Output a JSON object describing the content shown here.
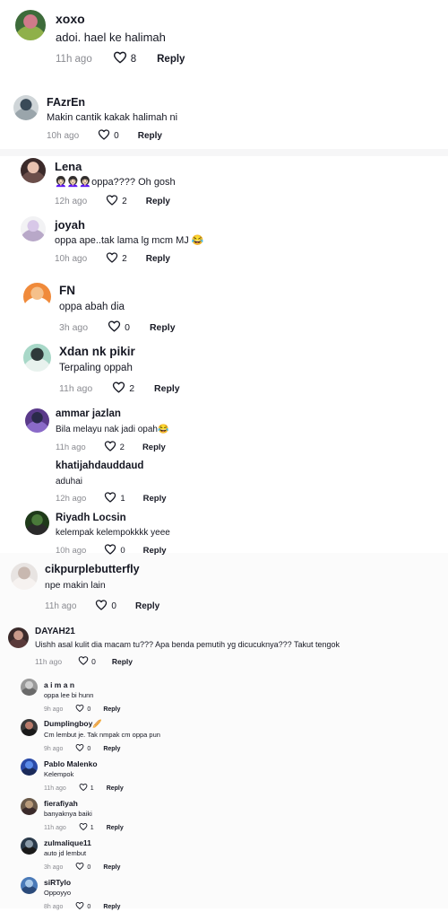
{
  "comments": [
    {
      "name": "xoxo",
      "text": "adoi. hael ke halimah",
      "time": "11h ago",
      "likes": "8",
      "reply": "Reply",
      "avatar": [
        "#3d6b3a",
        "#d07a8a",
        "#8fb04a"
      ]
    },
    {
      "name": "FAzrEn",
      "text": "Makin cantik kakak halimah ni",
      "time": "10h ago",
      "likes": "0",
      "reply": "Reply",
      "avatar": [
        "#cfd5d8",
        "#3a4a58",
        "#9aa5ab"
      ]
    },
    {
      "name": "Lena",
      "text": "👩🏻‍🦱👩🏻‍🦱👩🏻‍🦱oppa???? Oh gosh",
      "time": "12h ago",
      "likes": "2",
      "reply": "Reply",
      "avatar": [
        "#3b2a2a",
        "#e8c2b0",
        "#6b4e4a"
      ]
    },
    {
      "name": "joyah",
      "text": "oppa ape..tak lama lg mcm MJ 😂",
      "time": "10h ago",
      "likes": "2",
      "reply": "Reply",
      "avatar": [
        "#f2f2f4",
        "#d8c8e8",
        "#b8a8c8"
      ]
    },
    {
      "name": "FN",
      "text": "oppa abah dia",
      "time": "3h ago",
      "likes": "0",
      "reply": "Reply",
      "avatar": [
        "#f08a3a",
        "#f5c08a",
        "#ffffff"
      ]
    },
    {
      "name": "Xdan nk pikir",
      "text": "Terpaling oppah",
      "time": "11h ago",
      "likes": "2",
      "reply": "Reply",
      "avatar": [
        "#a8d8c8",
        "#2f3a3a",
        "#e8f2ee"
      ]
    },
    {
      "name": "ammar jazlan",
      "text": "Bila melayu nak jadi opah😂",
      "time": "11h ago",
      "likes": "2",
      "reply": "Reply",
      "avatar": [
        "#5a3a8a",
        "#2a2a4a",
        "#8a6ac8"
      ]
    },
    {
      "name": "khatijahdauddaud",
      "text": "aduhai",
      "time": "12h ago",
      "likes": "1",
      "reply": "Reply",
      "avatar": null
    },
    {
      "name": "Riyadh Locsin",
      "text": "kelempak kelempokkkk yeee",
      "time": "10h ago",
      "likes": "0",
      "reply": "Reply",
      "avatar": [
        "#1f3a1a",
        "#4a7a3a",
        "#2a2a2a"
      ]
    },
    {
      "name": "cikpurplebutterfly",
      "text": "npe makin lain",
      "time": "11h ago",
      "likes": "0",
      "reply": "Reply",
      "avatar": [
        "#e8e4e2",
        "#c8b8b0",
        "#f6f2f0"
      ]
    },
    {
      "name": "DAYAH21",
      "text": "Uishh asal kulit dia macam tu??? Apa benda pemutih yg dicucuknya??? Takut tengok",
      "time": "11h ago",
      "likes": "0",
      "reply": "Reply",
      "avatar": [
        "#3a2a2a",
        "#c89a8a",
        "#5a3a3a"
      ]
    },
    {
      "name": "a i m a n",
      "text": "oppa lee bi hunn",
      "time": "9h ago",
      "likes": "0",
      "reply": "Reply",
      "avatar": [
        "#9a9a9a",
        "#cfcfcf",
        "#6a6a6a"
      ]
    },
    {
      "name": "Dumplingboy🥖",
      "text": "Cm lembut je. Tak nmpak cm oppa pun",
      "time": "9h ago",
      "likes": "0",
      "reply": "Reply",
      "avatar": [
        "#3a3a3a",
        "#b87a6a",
        "#1a1a1a"
      ]
    },
    {
      "name": "Pablo Malenko",
      "text": "Kelempok",
      "time": "11h ago",
      "likes": "1",
      "reply": "Reply",
      "avatar": [
        "#2a4aa8",
        "#5a8ae8",
        "#1a2a5a"
      ]
    },
    {
      "name": "fierafiyah",
      "text": "banyaknya baiki",
      "time": "11h ago",
      "likes": "1",
      "reply": "Reply",
      "avatar": [
        "#6a5a4a",
        "#b89a7a",
        "#3a2a2a"
      ]
    },
    {
      "name": "zulmalique11",
      "text": "auto jd lembut",
      "time": "3h ago",
      "likes": "0",
      "reply": "Reply",
      "avatar": [
        "#2a3a4a",
        "#8a9aa8",
        "#1a1a1a"
      ]
    },
    {
      "name": "siRTylo",
      "text": "Oppoyyo",
      "time": "8h ago",
      "likes": "0",
      "reply": "Reply",
      "avatar": [
        "#4a7ab8",
        "#a8c8e8",
        "#2a4a7a"
      ]
    }
  ]
}
